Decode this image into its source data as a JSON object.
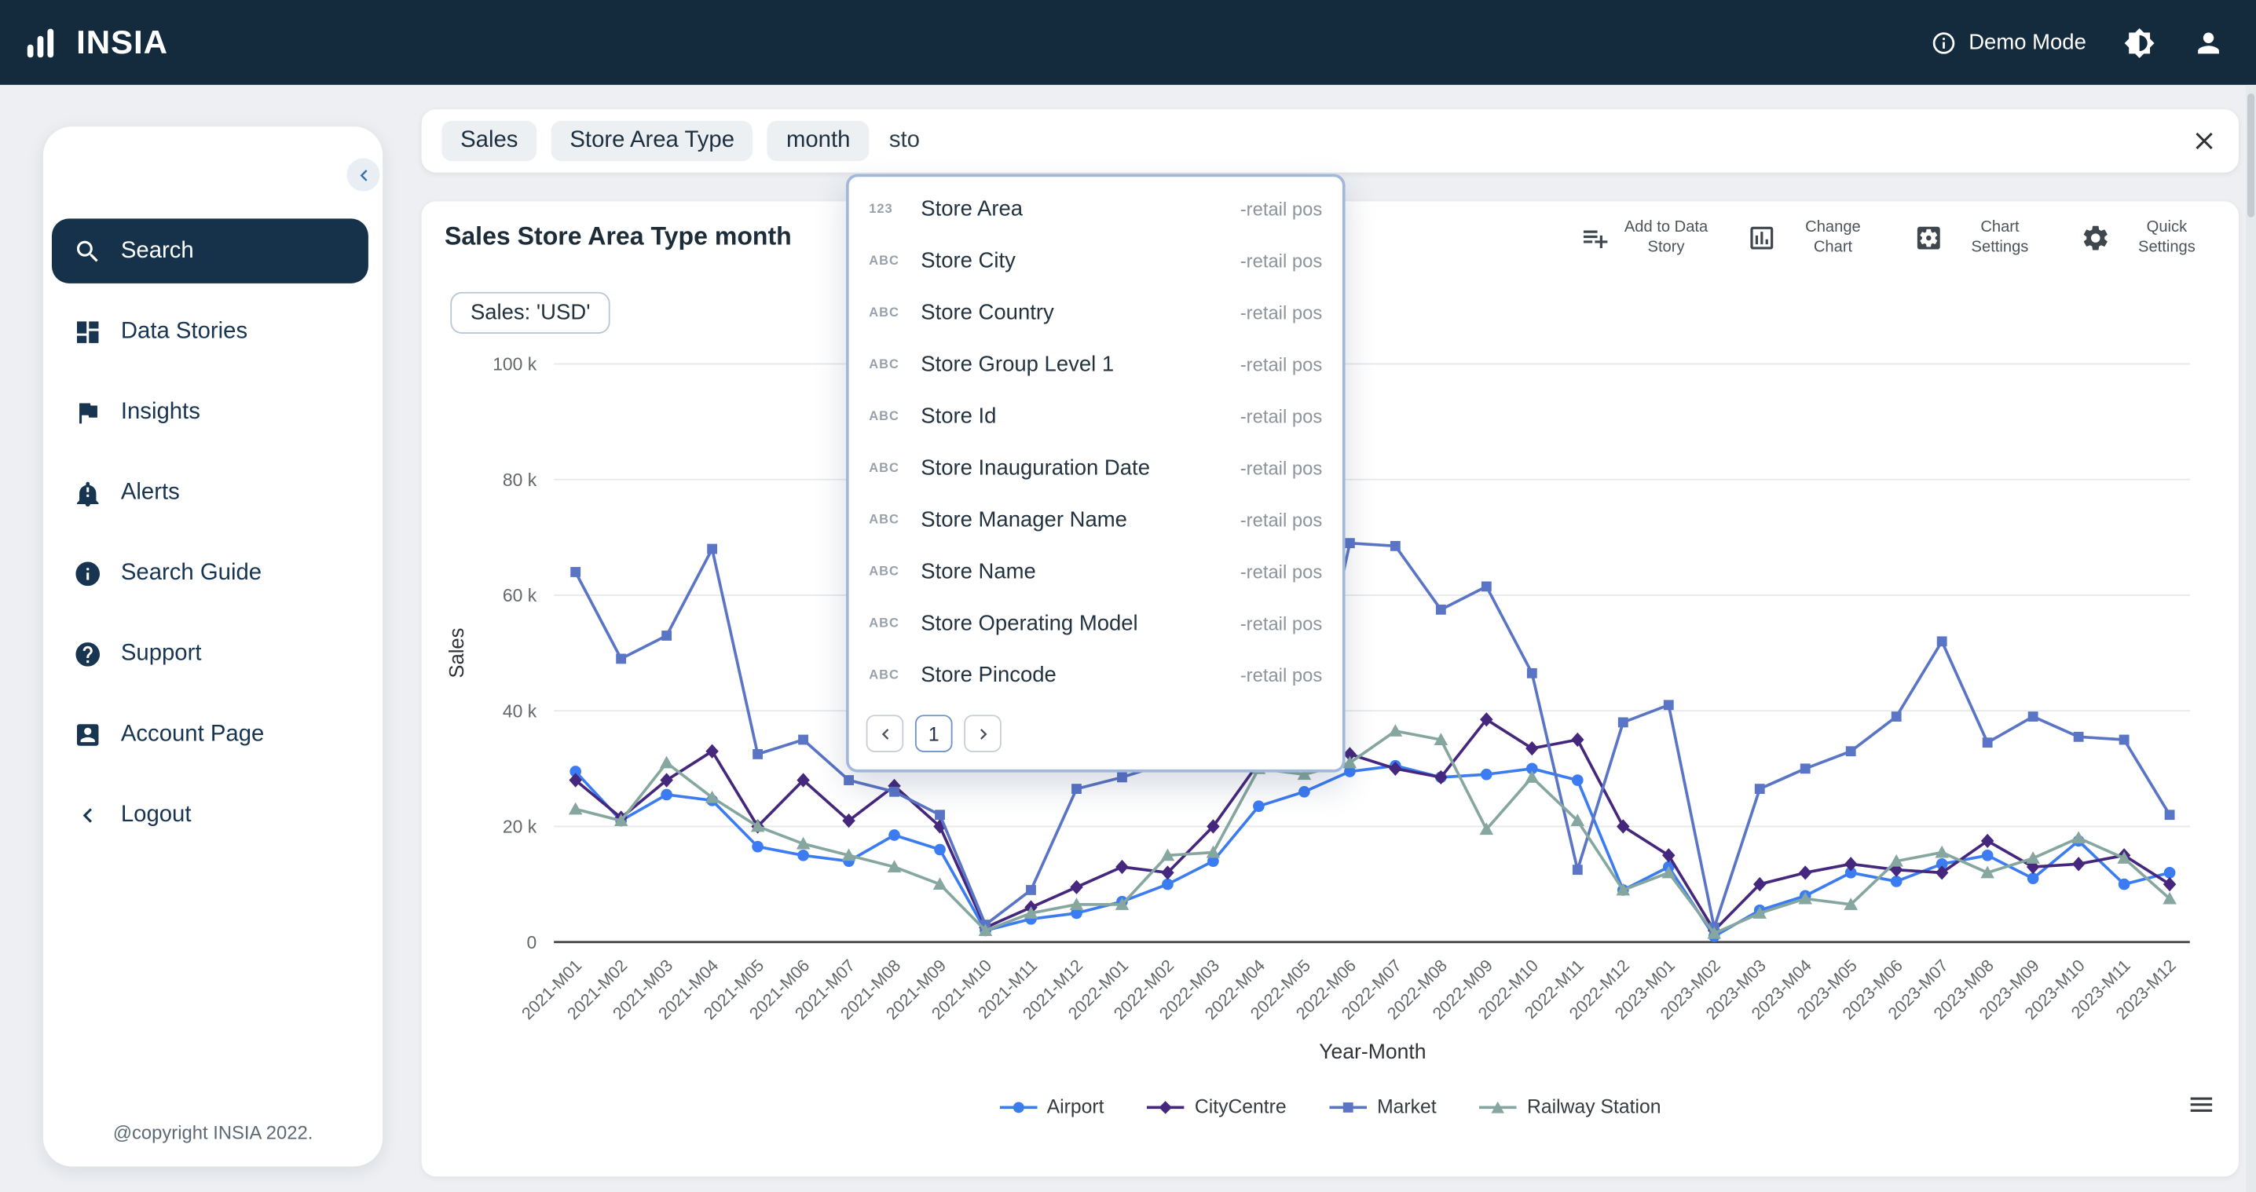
{
  "navbar": {
    "brand": "INSIA",
    "demo_mode_label": "Demo Mode"
  },
  "sidebar": {
    "items": [
      {
        "label": "Search",
        "icon": "search",
        "active": true
      },
      {
        "label": "Data Stories",
        "icon": "dashboard",
        "active": false
      },
      {
        "label": "Insights",
        "icon": "flag",
        "active": false
      },
      {
        "label": "Alerts",
        "icon": "bell",
        "active": false
      },
      {
        "label": "Search Guide",
        "icon": "info",
        "active": false
      },
      {
        "label": "Support",
        "icon": "help",
        "active": false
      },
      {
        "label": "Account Page",
        "icon": "account",
        "active": false
      },
      {
        "label": "Logout",
        "icon": "chevron-left",
        "active": false
      }
    ],
    "footer": "@copyright INSIA 2022."
  },
  "search": {
    "chips": [
      "Sales",
      "Store Area Type",
      "month"
    ],
    "query": "sto"
  },
  "suggestions": {
    "items": [
      {
        "type": "123",
        "label": "Store Area",
        "source": "-retail pos"
      },
      {
        "type": "ABC",
        "label": "Store City",
        "source": "-retail pos"
      },
      {
        "type": "ABC",
        "label": "Store Country",
        "source": "-retail pos"
      },
      {
        "type": "ABC",
        "label": "Store Group Level 1",
        "source": "-retail pos"
      },
      {
        "type": "ABC",
        "label": "Store Id",
        "source": "-retail pos"
      },
      {
        "type": "ABC",
        "label": "Store Inauguration Date",
        "source": "-retail pos"
      },
      {
        "type": "ABC",
        "label": "Store Manager Name",
        "source": "-retail pos"
      },
      {
        "type": "ABC",
        "label": "Store Name",
        "source": "-retail pos"
      },
      {
        "type": "ABC",
        "label": "Store Operating Model",
        "source": "-retail pos"
      },
      {
        "type": "ABC",
        "label": "Store Pincode",
        "source": "-retail pos"
      }
    ],
    "pagination": {
      "current": "1"
    }
  },
  "card": {
    "title": "Sales Store Area Type month",
    "filter_chip": "Sales: 'USD'",
    "toolbar": [
      {
        "label": "Add to Data Story",
        "icon": "playlist-add"
      },
      {
        "label": "Change Chart",
        "icon": "chart-box"
      },
      {
        "label": "Chart Settings",
        "icon": "settings-box"
      },
      {
        "label": "Quick Settings",
        "icon": "gear"
      }
    ]
  },
  "chart_data": {
    "type": "line",
    "title": "Sales Store Area Type month",
    "xlabel": "Year-Month",
    "ylabel": "Sales",
    "unit": "thousands (k)",
    "ylim": [
      0,
      100
    ],
    "yticks": [
      "0",
      "20 k",
      "40 k",
      "60 k",
      "80 k",
      "100 k"
    ],
    "grid": true,
    "legend_position": "bottom",
    "categories": [
      "2021-M01",
      "2021-M02",
      "2021-M03",
      "2021-M04",
      "2021-M05",
      "2021-M06",
      "2021-M07",
      "2021-M08",
      "2021-M09",
      "2021-M10",
      "2021-M11",
      "2021-M12",
      "2022-M01",
      "2022-M02",
      "2022-M03",
      "2022-M04",
      "2022-M05",
      "2022-M06",
      "2022-M07",
      "2022-M08",
      "2022-M09",
      "2022-M10",
      "2022-M11",
      "2022-M12",
      "2023-M01",
      "2023-M02",
      "2023-M03",
      "2023-M04",
      "2023-M05",
      "2023-M06",
      "2023-M07",
      "2023-M08",
      "2023-M09",
      "2023-M10",
      "2023-M11",
      "2023-M12"
    ],
    "series": [
      {
        "name": "Airport",
        "marker": "circle",
        "color": "#3b7cf2",
        "values": [
          29.5,
          21,
          25.5,
          24.5,
          16.5,
          15,
          14,
          18.5,
          16,
          2,
          4,
          5,
          7,
          10,
          14,
          23.5,
          26,
          29.5,
          30.5,
          28.5,
          29,
          30,
          28,
          9,
          13,
          1,
          5.5,
          8,
          12,
          10.5,
          13.5,
          15,
          11,
          17.5,
          10,
          12
        ]
      },
      {
        "name": "CityCentre",
        "marker": "diamond",
        "color": "#45277d",
        "values": [
          28,
          21.5,
          28,
          33,
          20,
          28,
          21,
          27,
          20,
          2.5,
          6,
          9.5,
          13,
          12,
          20,
          31,
          31.5,
          32.5,
          30,
          28.5,
          38.5,
          33.5,
          35,
          20,
          15,
          2,
          10,
          12,
          13.5,
          12.5,
          12,
          17.5,
          13,
          13.5,
          15,
          10
        ]
      },
      {
        "name": "Market",
        "marker": "square",
        "color": "#5a74c6",
        "values": [
          64,
          49,
          53,
          68,
          32.5,
          35,
          28,
          26,
          22,
          3,
          9,
          26.5,
          28.5,
          31,
          32.5,
          30.5,
          33,
          69,
          68.5,
          57.5,
          61.5,
          46.5,
          12.5,
          38,
          41,
          2.5,
          26.5,
          30,
          33,
          39,
          52,
          34.5,
          39,
          35.5,
          35,
          22
        ]
      },
      {
        "name": "Railway Station",
        "marker": "triangle",
        "color": "#86a79f",
        "values": [
          23,
          21,
          31,
          25,
          20,
          17,
          15,
          13,
          10,
          2,
          5,
          6.5,
          6.5,
          15,
          15.5,
          30,
          29,
          31,
          36.5,
          35,
          19.5,
          28.5,
          21,
          9,
          12,
          1.5,
          5,
          7.5,
          6.5,
          14,
          15.5,
          12,
          14.5,
          18,
          14.5,
          7.5
        ]
      }
    ]
  }
}
